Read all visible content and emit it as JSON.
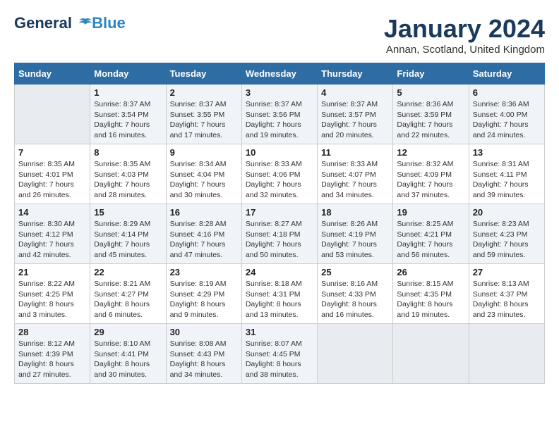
{
  "header": {
    "logo_line1": "General",
    "logo_line2": "Blue",
    "month": "January 2024",
    "location": "Annan, Scotland, United Kingdom"
  },
  "days_of_week": [
    "Sunday",
    "Monday",
    "Tuesday",
    "Wednesday",
    "Thursday",
    "Friday",
    "Saturday"
  ],
  "weeks": [
    [
      {
        "num": "",
        "empty": true
      },
      {
        "num": "1",
        "sunrise": "8:37 AM",
        "sunset": "3:54 PM",
        "daylight": "7 hours and 16 minutes."
      },
      {
        "num": "2",
        "sunrise": "8:37 AM",
        "sunset": "3:55 PM",
        "daylight": "7 hours and 17 minutes."
      },
      {
        "num": "3",
        "sunrise": "8:37 AM",
        "sunset": "3:56 PM",
        "daylight": "7 hours and 19 minutes."
      },
      {
        "num": "4",
        "sunrise": "8:37 AM",
        "sunset": "3:57 PM",
        "daylight": "7 hours and 20 minutes."
      },
      {
        "num": "5",
        "sunrise": "8:36 AM",
        "sunset": "3:59 PM",
        "daylight": "7 hours and 22 minutes."
      },
      {
        "num": "6",
        "sunrise": "8:36 AM",
        "sunset": "4:00 PM",
        "daylight": "7 hours and 24 minutes."
      }
    ],
    [
      {
        "num": "7",
        "sunrise": "8:35 AM",
        "sunset": "4:01 PM",
        "daylight": "7 hours and 26 minutes."
      },
      {
        "num": "8",
        "sunrise": "8:35 AM",
        "sunset": "4:03 PM",
        "daylight": "7 hours and 28 minutes."
      },
      {
        "num": "9",
        "sunrise": "8:34 AM",
        "sunset": "4:04 PM",
        "daylight": "7 hours and 30 minutes."
      },
      {
        "num": "10",
        "sunrise": "8:33 AM",
        "sunset": "4:06 PM",
        "daylight": "7 hours and 32 minutes."
      },
      {
        "num": "11",
        "sunrise": "8:33 AM",
        "sunset": "4:07 PM",
        "daylight": "7 hours and 34 minutes."
      },
      {
        "num": "12",
        "sunrise": "8:32 AM",
        "sunset": "4:09 PM",
        "daylight": "7 hours and 37 minutes."
      },
      {
        "num": "13",
        "sunrise": "8:31 AM",
        "sunset": "4:11 PM",
        "daylight": "7 hours and 39 minutes."
      }
    ],
    [
      {
        "num": "14",
        "sunrise": "8:30 AM",
        "sunset": "4:12 PM",
        "daylight": "7 hours and 42 minutes."
      },
      {
        "num": "15",
        "sunrise": "8:29 AM",
        "sunset": "4:14 PM",
        "daylight": "7 hours and 45 minutes."
      },
      {
        "num": "16",
        "sunrise": "8:28 AM",
        "sunset": "4:16 PM",
        "daylight": "7 hours and 47 minutes."
      },
      {
        "num": "17",
        "sunrise": "8:27 AM",
        "sunset": "4:18 PM",
        "daylight": "7 hours and 50 minutes."
      },
      {
        "num": "18",
        "sunrise": "8:26 AM",
        "sunset": "4:19 PM",
        "daylight": "7 hours and 53 minutes."
      },
      {
        "num": "19",
        "sunrise": "8:25 AM",
        "sunset": "4:21 PM",
        "daylight": "7 hours and 56 minutes."
      },
      {
        "num": "20",
        "sunrise": "8:23 AM",
        "sunset": "4:23 PM",
        "daylight": "7 hours and 59 minutes."
      }
    ],
    [
      {
        "num": "21",
        "sunrise": "8:22 AM",
        "sunset": "4:25 PM",
        "daylight": "8 hours and 3 minutes."
      },
      {
        "num": "22",
        "sunrise": "8:21 AM",
        "sunset": "4:27 PM",
        "daylight": "8 hours and 6 minutes."
      },
      {
        "num": "23",
        "sunrise": "8:19 AM",
        "sunset": "4:29 PM",
        "daylight": "8 hours and 9 minutes."
      },
      {
        "num": "24",
        "sunrise": "8:18 AM",
        "sunset": "4:31 PM",
        "daylight": "8 hours and 13 minutes."
      },
      {
        "num": "25",
        "sunrise": "8:16 AM",
        "sunset": "4:33 PM",
        "daylight": "8 hours and 16 minutes."
      },
      {
        "num": "26",
        "sunrise": "8:15 AM",
        "sunset": "4:35 PM",
        "daylight": "8 hours and 19 minutes."
      },
      {
        "num": "27",
        "sunrise": "8:13 AM",
        "sunset": "4:37 PM",
        "daylight": "8 hours and 23 minutes."
      }
    ],
    [
      {
        "num": "28",
        "sunrise": "8:12 AM",
        "sunset": "4:39 PM",
        "daylight": "8 hours and 27 minutes."
      },
      {
        "num": "29",
        "sunrise": "8:10 AM",
        "sunset": "4:41 PM",
        "daylight": "8 hours and 30 minutes."
      },
      {
        "num": "30",
        "sunrise": "8:08 AM",
        "sunset": "4:43 PM",
        "daylight": "8 hours and 34 minutes."
      },
      {
        "num": "31",
        "sunrise": "8:07 AM",
        "sunset": "4:45 PM",
        "daylight": "8 hours and 38 minutes."
      },
      {
        "num": "",
        "empty": true
      },
      {
        "num": "",
        "empty": true
      },
      {
        "num": "",
        "empty": true
      }
    ]
  ]
}
